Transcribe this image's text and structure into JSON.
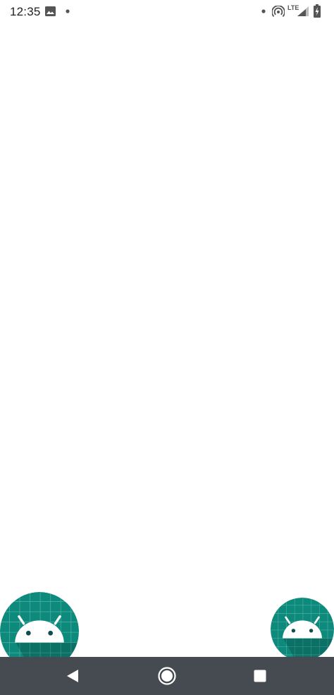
{
  "status_bar": {
    "time": "12:35",
    "network_label": "LTE",
    "icons": [
      "gallery-icon",
      "notification-dot-icon",
      "hotspot-icon",
      "signal-icon",
      "battery-charging-icon"
    ]
  },
  "app_icons": [
    {
      "name": "android-app-icon",
      "color": "#0d8a7c"
    },
    {
      "name": "android-app-icon",
      "color": "#0d8a7c"
    }
  ],
  "nav_bar": {
    "color": "#454b51",
    "buttons": [
      "back-icon",
      "home-icon",
      "recents-icon"
    ]
  }
}
